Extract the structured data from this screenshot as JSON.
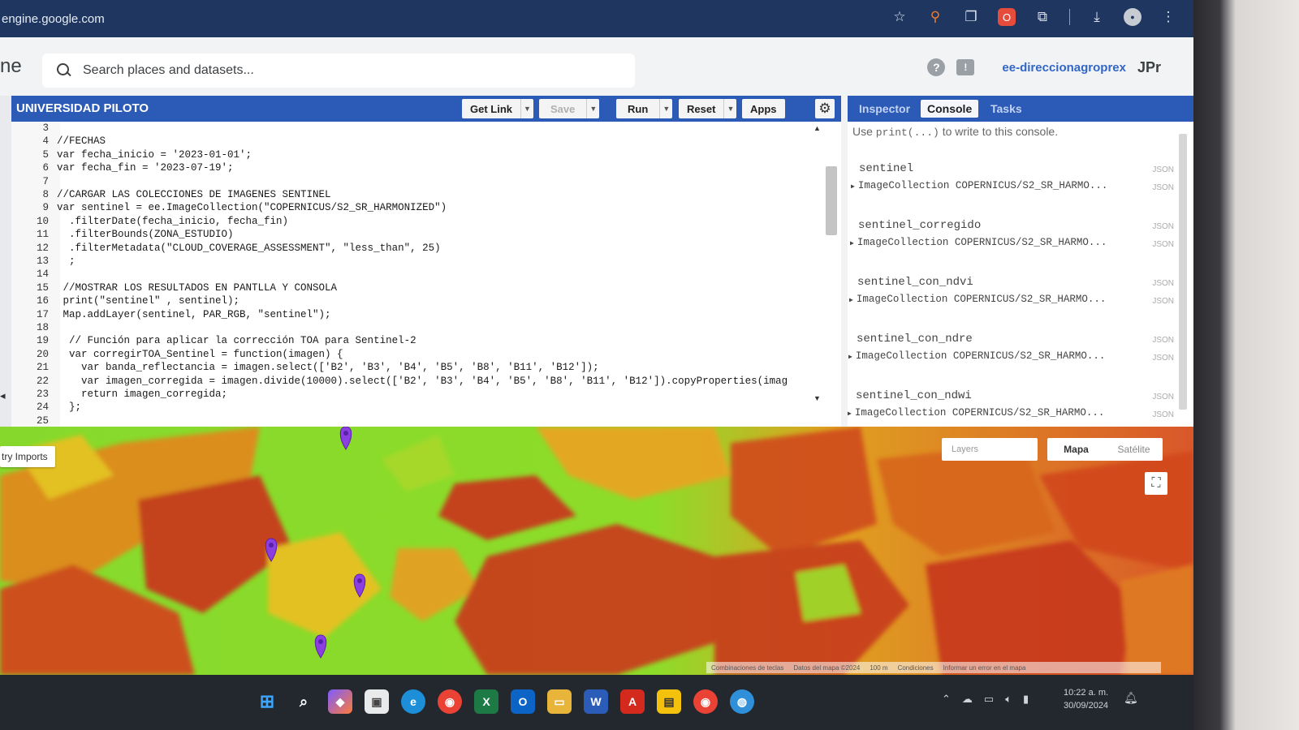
{
  "browser": {
    "url": "engine.google.com"
  },
  "header": {
    "logo": "ne",
    "search_placeholder": "Search places and datasets...",
    "account": "ee-direccionagroprex",
    "account_avatar": "JPr"
  },
  "editor": {
    "script_title": "UNIVERSIDAD PILOTO",
    "buttons": {
      "get_link": "Get Link",
      "save": "Save",
      "run": "Run",
      "reset": "Reset",
      "apps": "Apps"
    },
    "lines": [
      {
        "n": "3",
        "text": ""
      },
      {
        "n": "4",
        "text": "//FECHAS"
      },
      {
        "n": "5",
        "text": "var fecha_inicio = '2023-01-01';"
      },
      {
        "n": "6",
        "text": "var fecha_fin = '2023-07-19';"
      },
      {
        "n": "7",
        "text": ""
      },
      {
        "n": "8",
        "text": "//CARGAR LAS COLECCIONES DE IMAGENES SENTINEL"
      },
      {
        "n": "9",
        "text": "var sentinel = ee.ImageCollection(\"COPERNICUS/S2_SR_HARMONIZED\")"
      },
      {
        "n": "10",
        "text": "  .filterDate(fecha_inicio, fecha_fin)"
      },
      {
        "n": "11",
        "text": "  .filterBounds(ZONA_ESTUDIO)"
      },
      {
        "n": "12",
        "text": "  .filterMetadata(\"CLOUD_COVERAGE_ASSESSMENT\", \"less_than\", 25)"
      },
      {
        "n": "13",
        "text": "  ;"
      },
      {
        "n": "14",
        "text": ""
      },
      {
        "n": "15",
        "text": " //MOSTRAR LOS RESULTADOS EN PANTLLA Y CONSOLA"
      },
      {
        "n": "16",
        "text": " print(\"sentinel\" , sentinel);"
      },
      {
        "n": "17",
        "text": " Map.addLayer(sentinel, PAR_RGB, \"sentinel\");"
      },
      {
        "n": "18",
        "text": ""
      },
      {
        "n": "19",
        "text": "  // Función para aplicar la corrección TOA para Sentinel-2"
      },
      {
        "n": "20",
        "text": "  var corregirTOA_Sentinel = function(imagen) {"
      },
      {
        "n": "21",
        "text": "    var banda_reflectancia = imagen.select(['B2', 'B3', 'B4', 'B5', 'B8', 'B11', 'B12']);"
      },
      {
        "n": "22",
        "text": "    var imagen_corregida = imagen.divide(10000).select(['B2', 'B3', 'B4', 'B5', 'B8', 'B11', 'B12']).copyProperties(imag"
      },
      {
        "n": "23",
        "text": "    return imagen_corregida;"
      },
      {
        "n": "24",
        "text": "  };"
      },
      {
        "n": "25",
        "text": ""
      }
    ]
  },
  "right_panel": {
    "tabs": [
      "Inspector",
      "Console",
      "Tasks"
    ],
    "active_tab": "Console",
    "hint_prefix": "Use ",
    "hint_code": "print(...)",
    "hint_suffix": " to write to this console.",
    "json_tag": "JSON",
    "entries": [
      {
        "name": "sentinel",
        "value": "ImageCollection COPERNICUS/S2_SR_HARMO..."
      },
      {
        "name": "sentinel_corregido",
        "value": "ImageCollection COPERNICUS/S2_SR_HARMO..."
      },
      {
        "name": "sentinel_con_ndvi",
        "value": "ImageCollection COPERNICUS/S2_SR_HARMO..."
      },
      {
        "name": "sentinel_con_ndre",
        "value": "ImageCollection COPERNICUS/S2_SR_HARMO..."
      },
      {
        "name": "sentinel_con_ndwi",
        "value": "ImageCollection COPERNICUS/S2_SR_HARMO..."
      }
    ]
  },
  "map": {
    "imports_label": "try Imports",
    "layers_label": "Layers",
    "map_type_options": [
      "Mapa",
      "Satélite"
    ],
    "selected_map_type": "Mapa",
    "attribution": [
      "Combinaciones de teclas",
      "Datos del mapa ©2024",
      "100 m",
      "Condiciones",
      "Informar un error en el mapa"
    ]
  },
  "taskbar": {
    "time": "10:22 a. m.",
    "date": "30/09/2024"
  },
  "colors": {
    "accent_blue": "#2c5bb7",
    "browser_bar": "#1f3660",
    "account_text": "#3266c8",
    "marker_purple": "#8b3fe0",
    "map_green": "#7fd327",
    "map_red": "#d24a1e"
  }
}
